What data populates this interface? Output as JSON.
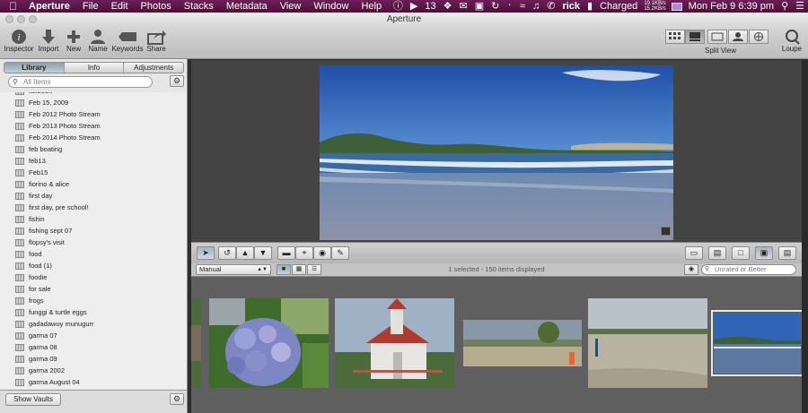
{
  "menubar": {
    "app": "Aperture",
    "items": [
      "File",
      "Edit",
      "Photos",
      "Stacks",
      "Metadata",
      "View",
      "Window",
      "Help"
    ],
    "status": {
      "badge_count": "13",
      "user": "rick",
      "battery": "Charged",
      "net_up": "19.1KB/s",
      "net_down": "15.2KB/s",
      "clock": "Mon Feb 9  6:39 pm"
    }
  },
  "window": {
    "title": "Aperture"
  },
  "toolbar": {
    "inspector": "Inspector",
    "import": "Import",
    "new": "New",
    "name": "Name",
    "keywords": "Keywords",
    "share": "Share",
    "split_view": "Split View",
    "loupe": "Loupe"
  },
  "sidebar": {
    "tabs": [
      "Library",
      "Info",
      "Adjustments"
    ],
    "active_tab": "Library",
    "search_placeholder": "All Items",
    "items": [
      "fallbook",
      "Feb 15, 2009",
      "Feb 2012 Photo Stream",
      "Feb 2013 Photo Stream",
      "Feb 2014 Photo Stream",
      "feb boating",
      "feb13",
      "Feb15",
      "fiorino & alice",
      "first day",
      "first day, pre school!",
      "fishin",
      "fishing sept 07",
      "flopsy's visit",
      "food",
      "food (1)",
      "foodie",
      "for sale",
      "frogs",
      "funggi & turtle eggs",
      "gadadawuy munugurr",
      "garma 07",
      "garma 08",
      "garma 09",
      "garma 2002",
      "garma August 04"
    ],
    "show_vaults": "Show Vaults"
  },
  "browser": {
    "sort": "Manual",
    "status": "1 selected - 150 items displayed",
    "rating_filter": "Unrated or Better"
  },
  "colors": {
    "menubar": "#5a1847",
    "sidebar": "#e6e6e6",
    "viewer": "#444444",
    "filmstrip": "#5f5f5f",
    "sky": "#2f65b8",
    "sea": "#5b78a0"
  }
}
